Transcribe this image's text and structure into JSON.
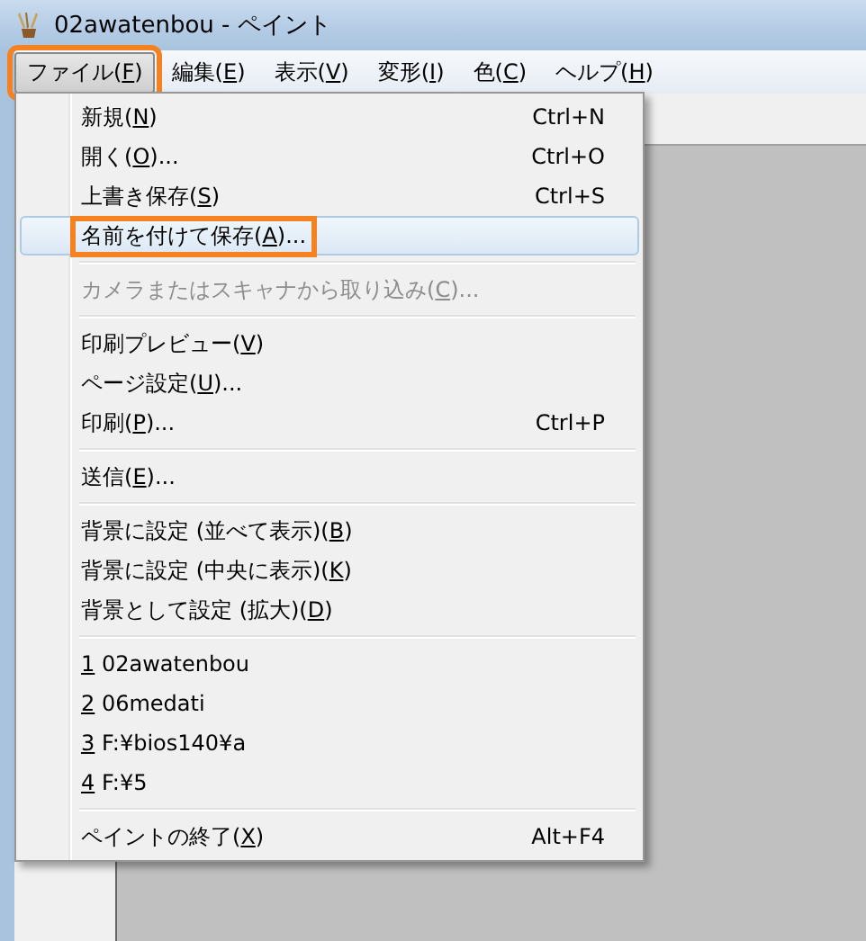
{
  "window": {
    "title": "02awatenbou - ペイント"
  },
  "menubar": [
    {
      "text_before": "ファイル(",
      "access_key": "F",
      "text_after": ")",
      "selected": true,
      "highlighted": true
    },
    {
      "text_before": "編集(",
      "access_key": "E",
      "text_after": ")",
      "selected": false,
      "highlighted": false
    },
    {
      "text_before": "表示(",
      "access_key": "V",
      "text_after": ")",
      "selected": false,
      "highlighted": false
    },
    {
      "text_before": "変形(",
      "access_key": "I",
      "text_after": ")",
      "selected": false,
      "highlighted": false
    },
    {
      "text_before": "色(",
      "access_key": "C",
      "text_after": ")",
      "selected": false,
      "highlighted": false
    },
    {
      "text_before": "ヘルプ(",
      "access_key": "H",
      "text_after": ")",
      "selected": false,
      "highlighted": false
    }
  ],
  "file_menu": [
    {
      "kind": "item",
      "text_before": "新規(",
      "access_key": "N",
      "text_after": ")",
      "shortcut": "Ctrl+N",
      "selected": false,
      "disabled": false,
      "highlighted": false
    },
    {
      "kind": "item",
      "text_before": "開く(",
      "access_key": "O",
      "text_after": ")...",
      "shortcut": "Ctrl+O",
      "selected": false,
      "disabled": false,
      "highlighted": false
    },
    {
      "kind": "item",
      "text_before": "上書き保存(",
      "access_key": "S",
      "text_after": ")",
      "shortcut": "Ctrl+S",
      "selected": false,
      "disabled": false,
      "highlighted": false
    },
    {
      "kind": "item",
      "text_before": "名前を付けて保存(",
      "access_key": "A",
      "text_after": ")...",
      "selected": true,
      "disabled": false,
      "highlighted": true
    },
    {
      "kind": "separator"
    },
    {
      "kind": "item",
      "text_before": "カメラまたはスキャナから取り込み(",
      "access_key": "C",
      "text_after": ")...",
      "selected": false,
      "disabled": true,
      "highlighted": false
    },
    {
      "kind": "separator"
    },
    {
      "kind": "item",
      "text_before": "印刷プレビュー(",
      "access_key": "V",
      "text_after": ")",
      "selected": false,
      "disabled": false,
      "highlighted": false
    },
    {
      "kind": "item",
      "text_before": "ページ設定(",
      "access_key": "U",
      "text_after": ")...",
      "selected": false,
      "disabled": false,
      "highlighted": false
    },
    {
      "kind": "item",
      "text_before": "印刷(",
      "access_key": "P",
      "text_after": ")...",
      "shortcut": "Ctrl+P",
      "selected": false,
      "disabled": false,
      "highlighted": false
    },
    {
      "kind": "separator"
    },
    {
      "kind": "item",
      "text_before": "送信(",
      "access_key": "E",
      "text_after": ")...",
      "selected": false,
      "disabled": false,
      "highlighted": false
    },
    {
      "kind": "separator"
    },
    {
      "kind": "item",
      "text_before": "背景に設定 (並べて表示)(",
      "access_key": "B",
      "text_after": ")",
      "selected": false,
      "disabled": false,
      "highlighted": false
    },
    {
      "kind": "item",
      "text_before": "背景に設定 (中央に表示)(",
      "access_key": "K",
      "text_after": ")",
      "selected": false,
      "disabled": false,
      "highlighted": false
    },
    {
      "kind": "item",
      "text_before": "背景として設定 (拡大)(",
      "access_key": "D",
      "text_after": ")",
      "selected": false,
      "disabled": false,
      "highlighted": false
    },
    {
      "kind": "separator"
    },
    {
      "kind": "item",
      "access_key": "1",
      "text_after": " 02awatenbou",
      "selected": false,
      "disabled": false,
      "highlighted": false
    },
    {
      "kind": "item",
      "access_key": "2",
      "text_after": " 06medati",
      "selected": false,
      "disabled": false,
      "highlighted": false
    },
    {
      "kind": "item",
      "access_key": "3",
      "text_after": " F:¥bios140¥a",
      "selected": false,
      "disabled": false,
      "highlighted": false
    },
    {
      "kind": "item",
      "access_key": "4",
      "text_after": " F:¥5",
      "selected": false,
      "disabled": false,
      "highlighted": false
    },
    {
      "kind": "separator"
    },
    {
      "kind": "item",
      "text_before": "ペイントの終了(",
      "access_key": "X",
      "text_after": ")",
      "shortcut": "Alt+F4",
      "selected": false,
      "disabled": false,
      "highlighted": false
    }
  ]
}
